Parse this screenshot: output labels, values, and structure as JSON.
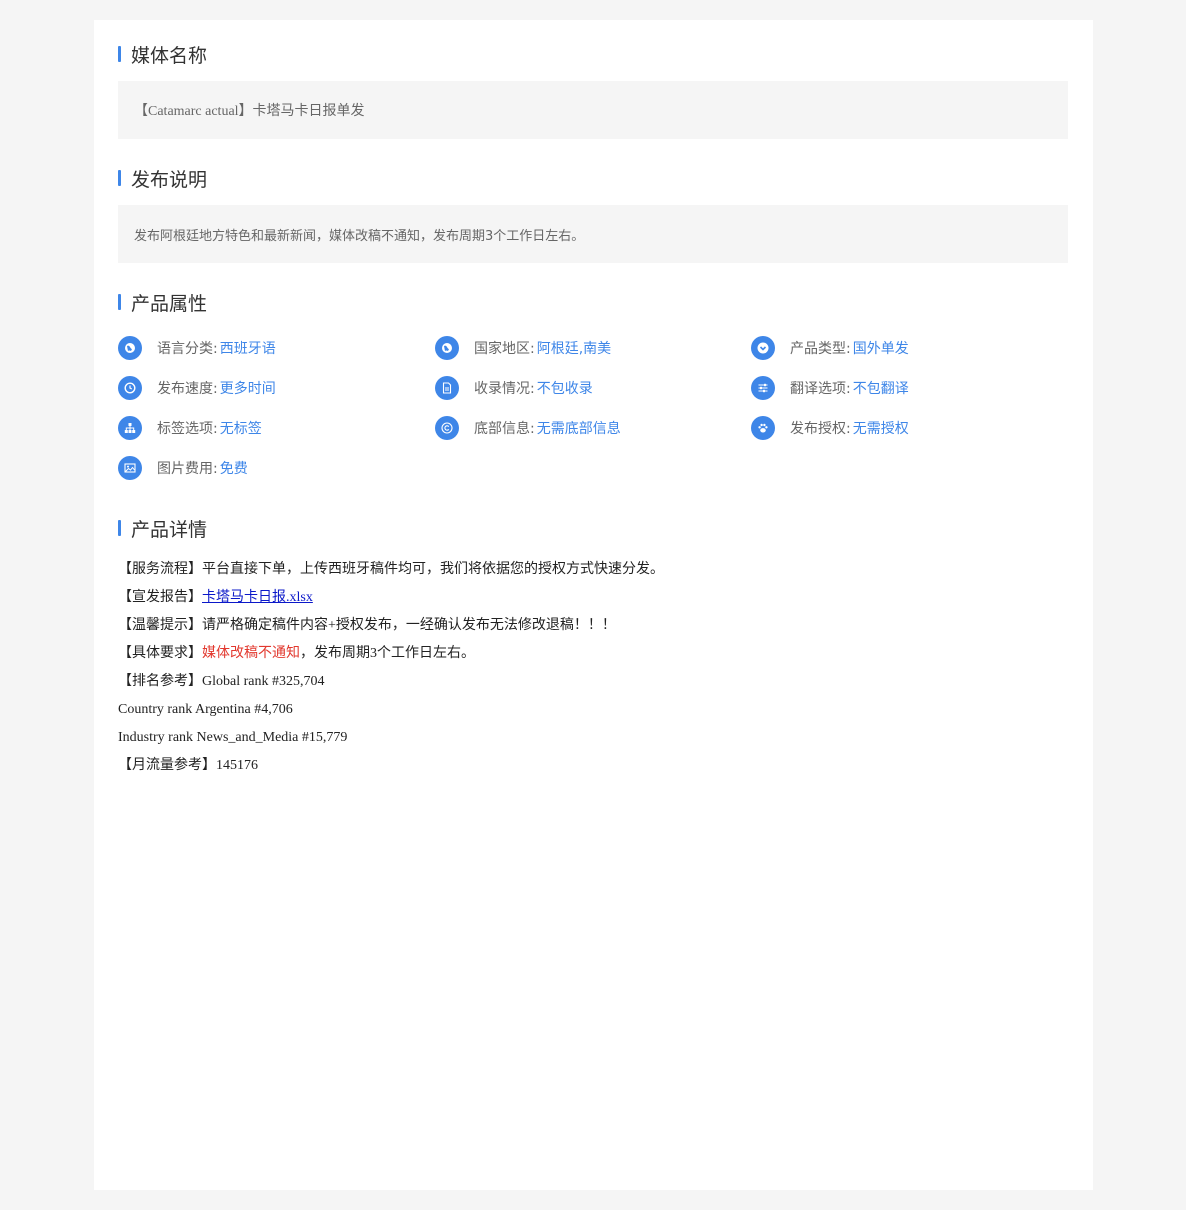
{
  "media": {
    "title": "媒体名称",
    "name": "【Catamarc actual】卡塔马卡日报单发"
  },
  "publish": {
    "title": "发布说明",
    "description": "发布阿根廷地方特色和最新新闻，媒体改稿不通知，发布周期3个工作日左右。"
  },
  "attributes": {
    "title": "产品属性",
    "items": [
      {
        "icon": "globe-icon",
        "label": "语言分类:",
        "value": "西班牙语"
      },
      {
        "icon": "globe-icon",
        "label": "国家地区:",
        "value": "阿根廷,南美"
      },
      {
        "icon": "chevron-down-circle-icon",
        "label": "产品类型:",
        "value": "国外单发"
      },
      {
        "icon": "clock-icon",
        "label": "发布速度:",
        "value": "更多时间"
      },
      {
        "icon": "document-icon",
        "label": "收录情况:",
        "value": "不包收录"
      },
      {
        "icon": "sliders-icon",
        "label": "翻译选项:",
        "value": "不包翻译"
      },
      {
        "icon": "sitemap-icon",
        "label": "标签选项:",
        "value": "无标签"
      },
      {
        "icon": "copyright-icon",
        "label": "底部信息:",
        "value": "无需底部信息"
      },
      {
        "icon": "paw-icon",
        "label": "发布授权:",
        "value": "无需授权"
      },
      {
        "icon": "image-icon",
        "label": "图片费用:",
        "value": "免费"
      }
    ]
  },
  "details": {
    "title": "产品详情",
    "service_prefix": "【服务流程】",
    "service_text": "平台直接下单，上传西班牙稿件均可，我们将依据您的授权方式快速分发。",
    "report_prefix": "【宣发报告】",
    "report_link": "卡塔马卡日报.xlsx",
    "tip_prefix": "【温馨提示】",
    "tip_text": "请严格确定稿件内容+授权发布，一经确认发布无法修改退稿！！！",
    "req_prefix": "【具体要求】",
    "req_red": "媒体改稿不通知",
    "req_text": "，发布周期3个工作日左右。",
    "rank_prefix": "【排名参考】",
    "global_rank": "Global rank #325,704",
    "country_rank": "Country rank Argentina #4,706",
    "industry_rank": "Industry rank News_and_Media #15,779",
    "traffic_prefix": "【月流量参考】",
    "traffic_value": "145176"
  },
  "colors": {
    "accent": "#3e86e8",
    "link": "#0b18c9",
    "warning": "#e2382e"
  }
}
